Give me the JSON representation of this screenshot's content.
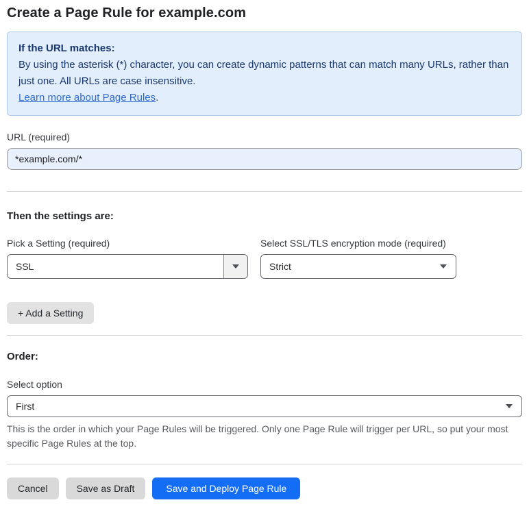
{
  "page": {
    "title": "Create a Page Rule for example.com"
  },
  "info_box": {
    "heading": "If the URL matches:",
    "body": "By using the asterisk (*) character, you can create dynamic patterns that can match many URLs, rather than just one. All URLs are case insensitive.",
    "link_label": "Learn more about Page Rules",
    "link_suffix": "."
  },
  "url_field": {
    "label": "URL (required)",
    "value": "*example.com/*"
  },
  "settings_section": {
    "heading": "Then the settings are:",
    "setting_picker": {
      "label": "Pick a Setting (required)",
      "value": "SSL"
    },
    "ssl_mode_picker": {
      "label": "Select SSL/TLS encryption mode (required)",
      "value": "Strict"
    },
    "add_setting_label": "+ Add a Setting"
  },
  "order_section": {
    "heading": "Order:",
    "select_label": "Select option",
    "value": "First",
    "help_text": "This is the order in which your Page Rules will be triggered. Only one Page Rule will trigger per URL, so put your most specific Page Rules at the top."
  },
  "footer": {
    "cancel_label": "Cancel",
    "save_draft_label": "Save as Draft",
    "save_deploy_label": "Save and Deploy Page Rule"
  },
  "colors": {
    "accent_blue": "#146ef5",
    "info_bg": "#e3eefc",
    "info_border": "#a8c8ea",
    "info_text": "#17376e",
    "link_blue": "#2f6bce",
    "input_autofill_bg": "#e8f0fe"
  }
}
